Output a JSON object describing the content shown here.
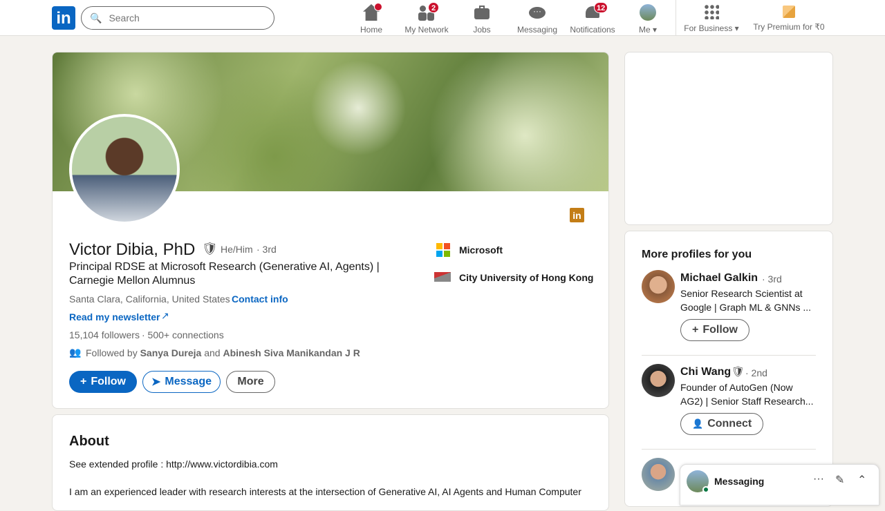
{
  "nav": {
    "search_placeholder": "Search",
    "items": [
      {
        "label": "Home",
        "badge": ""
      },
      {
        "label": "My Network",
        "badge": "2"
      },
      {
        "label": "Jobs",
        "badge": ""
      },
      {
        "label": "Messaging",
        "badge": ""
      },
      {
        "label": "Notifications",
        "badge": "12"
      },
      {
        "label": "Me",
        "badge": ""
      }
    ],
    "business": "For Business",
    "premium": "Try Premium for ₹0"
  },
  "profile": {
    "name": "Victor Dibia, PhD",
    "pronouns": "He/Him",
    "degree": "· 3rd",
    "headline": "Principal RDSE at Microsoft Research (Generative AI, Agents) | Carnegie Mellon Alumnus",
    "location": "Santa Clara, California, United States",
    "sep": "·",
    "contact": "Contact info",
    "newsletter": "Read my newsletter",
    "followers": "15,104 followers",
    "connections": "· 500+ connections",
    "followed_prefix": "Followed by",
    "followed_a": "Sanya Dureja",
    "followed_and": "and",
    "followed_b": "Abinesh Siva Manikandan J R",
    "follow": "Follow",
    "message": "Message",
    "more": "More",
    "company": "Microsoft",
    "school": "City University of Hong Kong"
  },
  "about": {
    "title": "About",
    "line1": "See extended profile : http://www.victordibia.com",
    "line2": "I am an experienced leader with research interests at the intersection of Generative AI, AI Agents and Human Computer"
  },
  "sidebar": {
    "title": "More profiles for you",
    "people": [
      {
        "name": "Michael Galkin",
        "degree": "· 3rd",
        "h1": "Senior Research Scientist at",
        "h2": "Google | Graph ML & GNNs ...",
        "action": "Follow"
      },
      {
        "name": "Chi Wang",
        "degree": "· 2nd",
        "h1": "Founder of AutoGen (Now",
        "h2": "AG2) | Senior Staff Research...",
        "action": "Connect"
      }
    ]
  },
  "messaging": {
    "label": "Messaging"
  },
  "colors": {
    "brand": "#0a66c2",
    "badge": "#cb112d"
  }
}
